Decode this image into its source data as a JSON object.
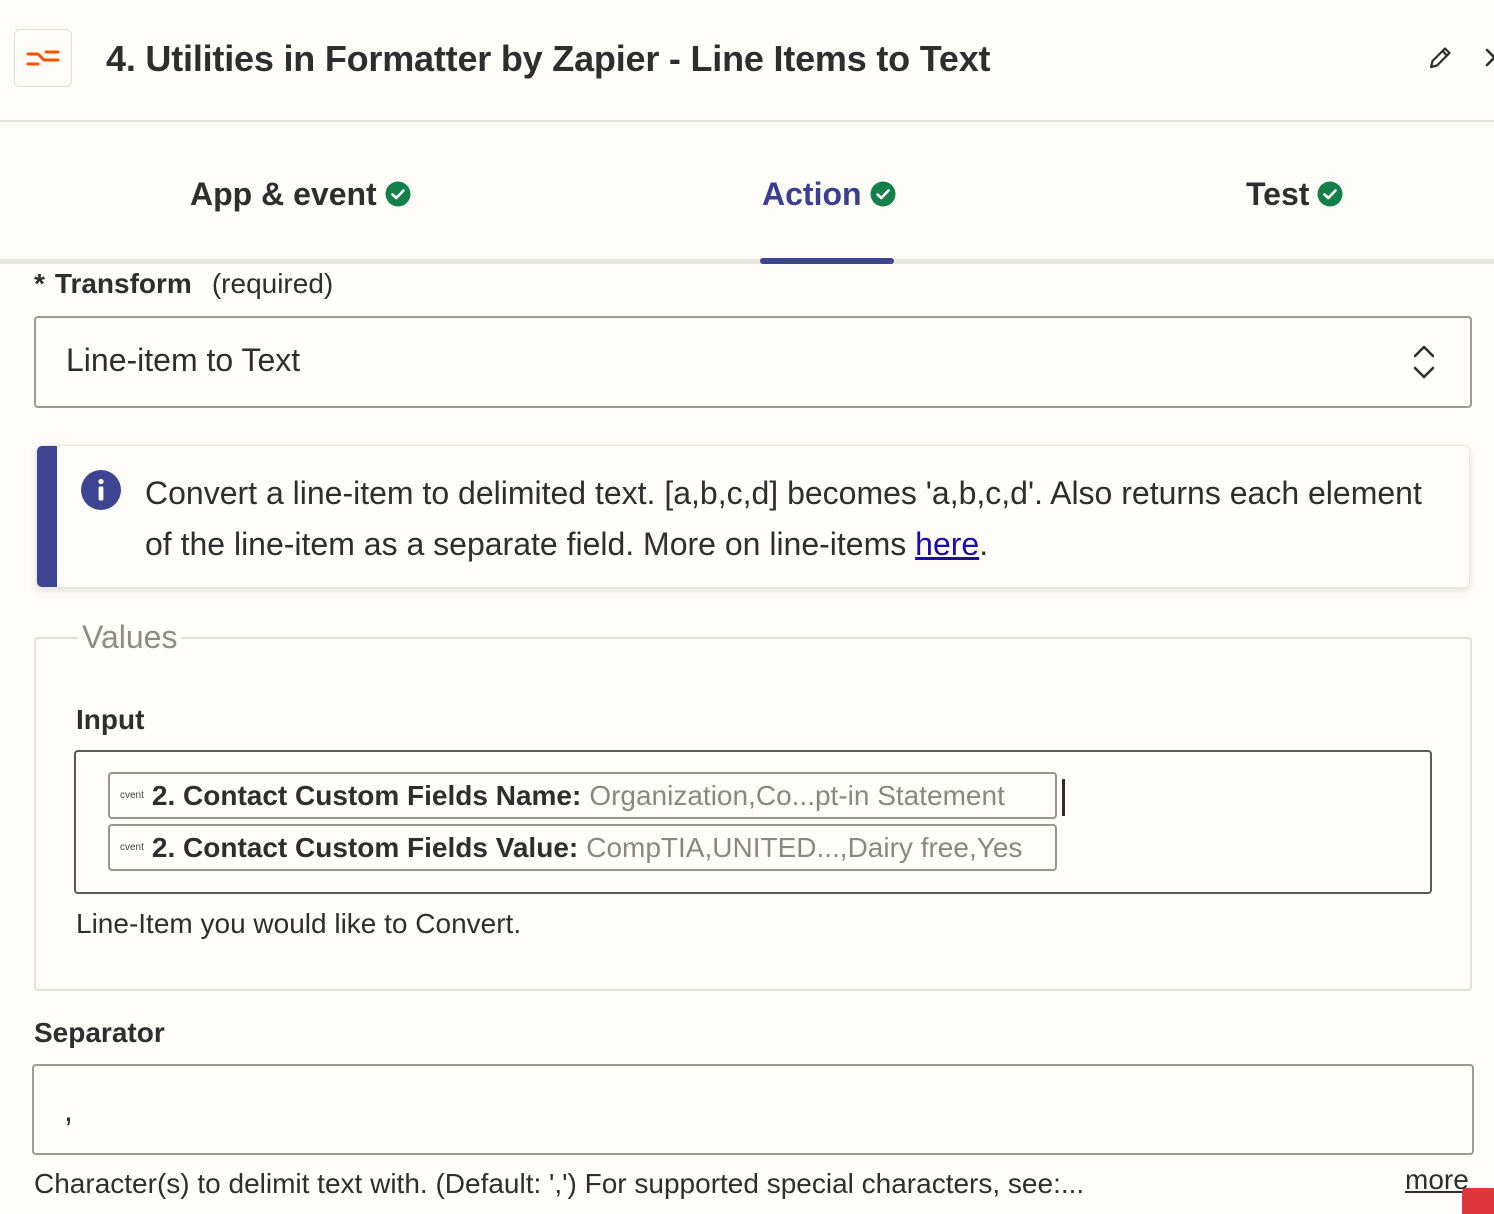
{
  "header": {
    "title": "4. Utilities in Formatter by Zapier - Line Items to Text",
    "app_icon": "formatter-icon",
    "accent_color": "#ff4f00"
  },
  "tabs": [
    {
      "label": "App & event",
      "complete": true
    },
    {
      "label": "Action",
      "complete": true,
      "active": true
    },
    {
      "label": "Test",
      "complete": true
    }
  ],
  "transform": {
    "required_marker": "*",
    "label": "Transform",
    "hint": "(required)",
    "value": "Line-item to Text"
  },
  "info": {
    "text": "Convert a line-item to delimited text. [a,b,c,d] becomes 'a,b,c,d'. Also returns each element of the line-item as a separate field. More on line-items ",
    "link_text": "here",
    "trailing": "."
  },
  "values": {
    "legend": "Values",
    "input_label": "Input",
    "pills": [
      {
        "logo": "cvent",
        "key": "2. Contact Custom Fields Name:",
        "value": "Organization,Co...pt-in Statement"
      },
      {
        "logo": "cvent",
        "key": "2. Contact Custom Fields Value:",
        "value": "CompTIA,UNITED...,Dairy free,Yes"
      }
    ],
    "help": "Line-Item you would like to Convert."
  },
  "separator": {
    "label": "Separator",
    "value": ",",
    "help": "Character(s) to delimit text with. (Default: ',') For supported special characters, see:...",
    "more": "more"
  },
  "colors": {
    "primary": "#3d4592",
    "success": "#13804b",
    "link": "#1a0dab"
  }
}
